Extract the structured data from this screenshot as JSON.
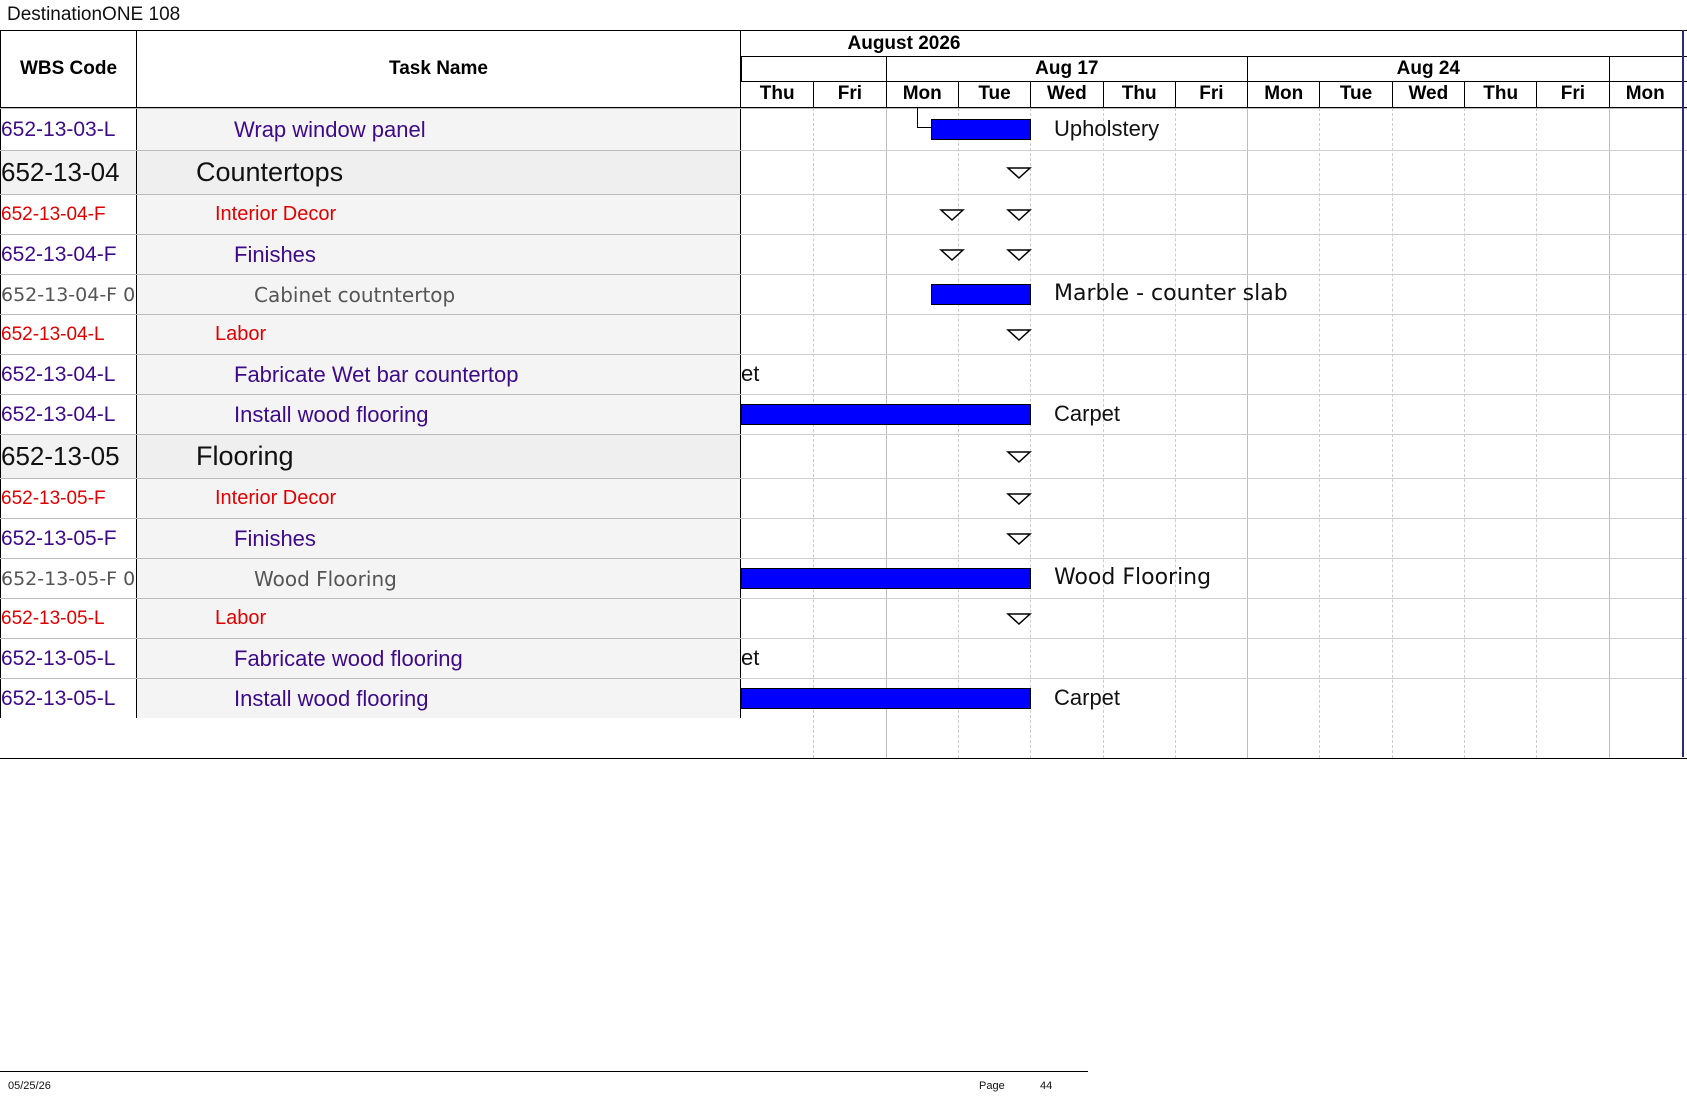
{
  "header": {
    "title": "DestinationONE 108"
  },
  "columns": {
    "wbs": "WBS Code",
    "task": "Task Name"
  },
  "timescale": {
    "month": "August 2026",
    "weeks": [
      "",
      "Aug 17",
      "Aug 24",
      ""
    ],
    "days": [
      "Thu",
      "Fri",
      "Mon",
      "Tue",
      "Wed",
      "Thu",
      "Fri",
      "Mon",
      "Tue",
      "Wed",
      "Thu",
      "Fri",
      "Mon"
    ]
  },
  "rows": [
    {
      "wbs": "652-13-03-L",
      "task": "Wrap window panel",
      "level": 3,
      "style": "purple",
      "bar_label": "Upholstery"
    },
    {
      "wbs": "652-13-04",
      "task": "Countertops",
      "level": 1,
      "style": "black"
    },
    {
      "wbs": "652-13-04-F",
      "task": "Interior Decor",
      "level": 2,
      "style": "red"
    },
    {
      "wbs": "652-13-04-F",
      "task": "Finishes",
      "level": 3,
      "style": "purple"
    },
    {
      "wbs": "652-13-04-F 0",
      "task": "Cabinet coutntertop",
      "level": 4,
      "style": "gray",
      "bar_label": "Marble - counter slab"
    },
    {
      "wbs": "652-13-04-L",
      "task": "Labor",
      "level": 2,
      "style": "red"
    },
    {
      "wbs": "652-13-04-L",
      "task": "Fabricate Wet bar countertop",
      "level": 3,
      "style": "purple",
      "overflow_text": "et"
    },
    {
      "wbs": "652-13-04-L",
      "task": "Install wood flooring",
      "level": 3,
      "style": "purple",
      "bar_label": "Carpet"
    },
    {
      "wbs": "652-13-05",
      "task": "Flooring",
      "level": 1,
      "style": "black"
    },
    {
      "wbs": "652-13-05-F",
      "task": "Interior Decor",
      "level": 2,
      "style": "red"
    },
    {
      "wbs": "652-13-05-F",
      "task": "Finishes",
      "level": 3,
      "style": "purple"
    },
    {
      "wbs": "652-13-05-F 0",
      "task": "Wood Flooring",
      "level": 4,
      "style": "gray",
      "bar_label": "Wood Flooring"
    },
    {
      "wbs": "652-13-05-L",
      "task": "Labor",
      "level": 2,
      "style": "red"
    },
    {
      "wbs": "652-13-05-L",
      "task": "Fabricate wood flooring",
      "level": 3,
      "style": "purple",
      "overflow_text": "et"
    },
    {
      "wbs": "652-13-05-L",
      "task": "Install wood flooring",
      "level": 3,
      "style": "purple",
      "bar_label": "Carpet"
    }
  ],
  "footer": {
    "date": "05/25/26",
    "page_label": "Page",
    "page_number": "44"
  },
  "colors": {
    "bar": "#0000ff",
    "purple_text": "#3d0a8a",
    "red_text": "#e00000",
    "gray_text": "#555555"
  }
}
